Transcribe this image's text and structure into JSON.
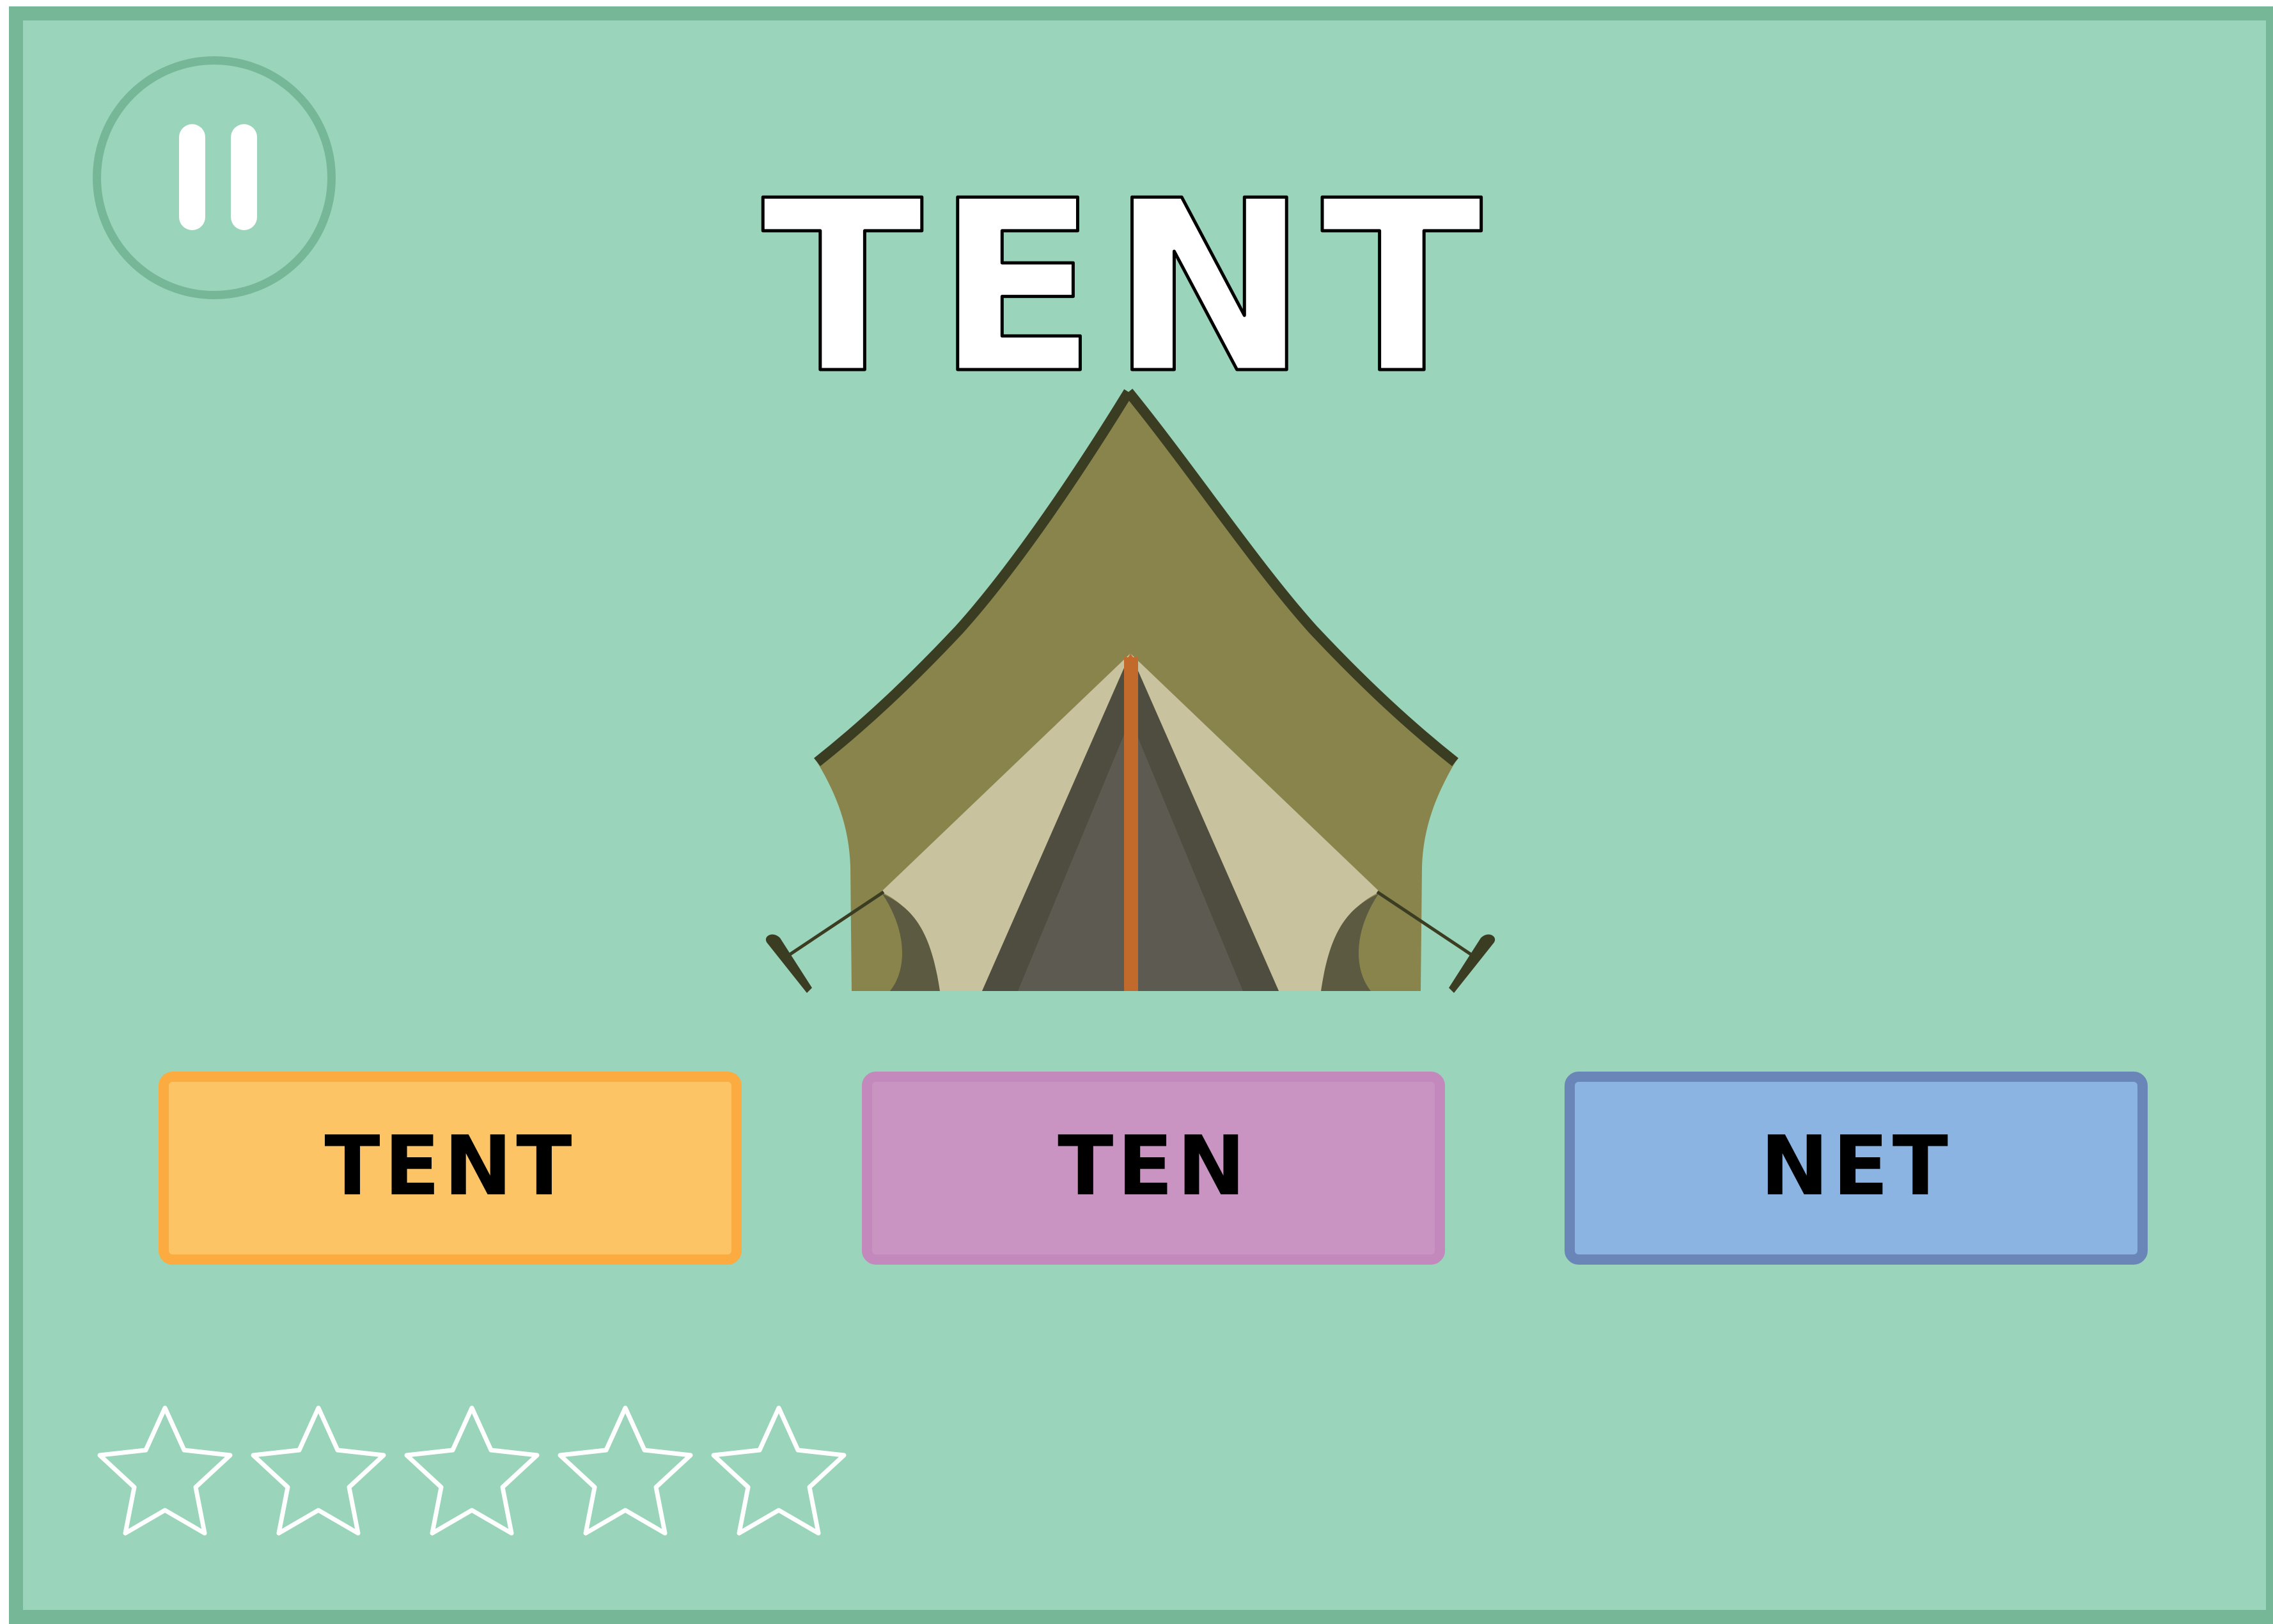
{
  "game": {
    "target_word": "TENT",
    "picture": "tent-image",
    "pause_icon": "pause-icon",
    "choices": [
      {
        "label": "TENT",
        "color": "#fdc466",
        "border": "#fbab3f"
      },
      {
        "label": "TEN",
        "color": "#c994c2",
        "border": "#c389bc"
      },
      {
        "label": "NET",
        "color": "#8bb4e2",
        "border": "#6a86b8"
      }
    ],
    "stars": {
      "total": 5,
      "earned": 0,
      "icon": "star-outline-icon"
    }
  },
  "colors": {
    "background": "#9ad4ba",
    "frame": "#75b796",
    "title_fill": "#ffffff",
    "title_stroke": "#000000"
  }
}
